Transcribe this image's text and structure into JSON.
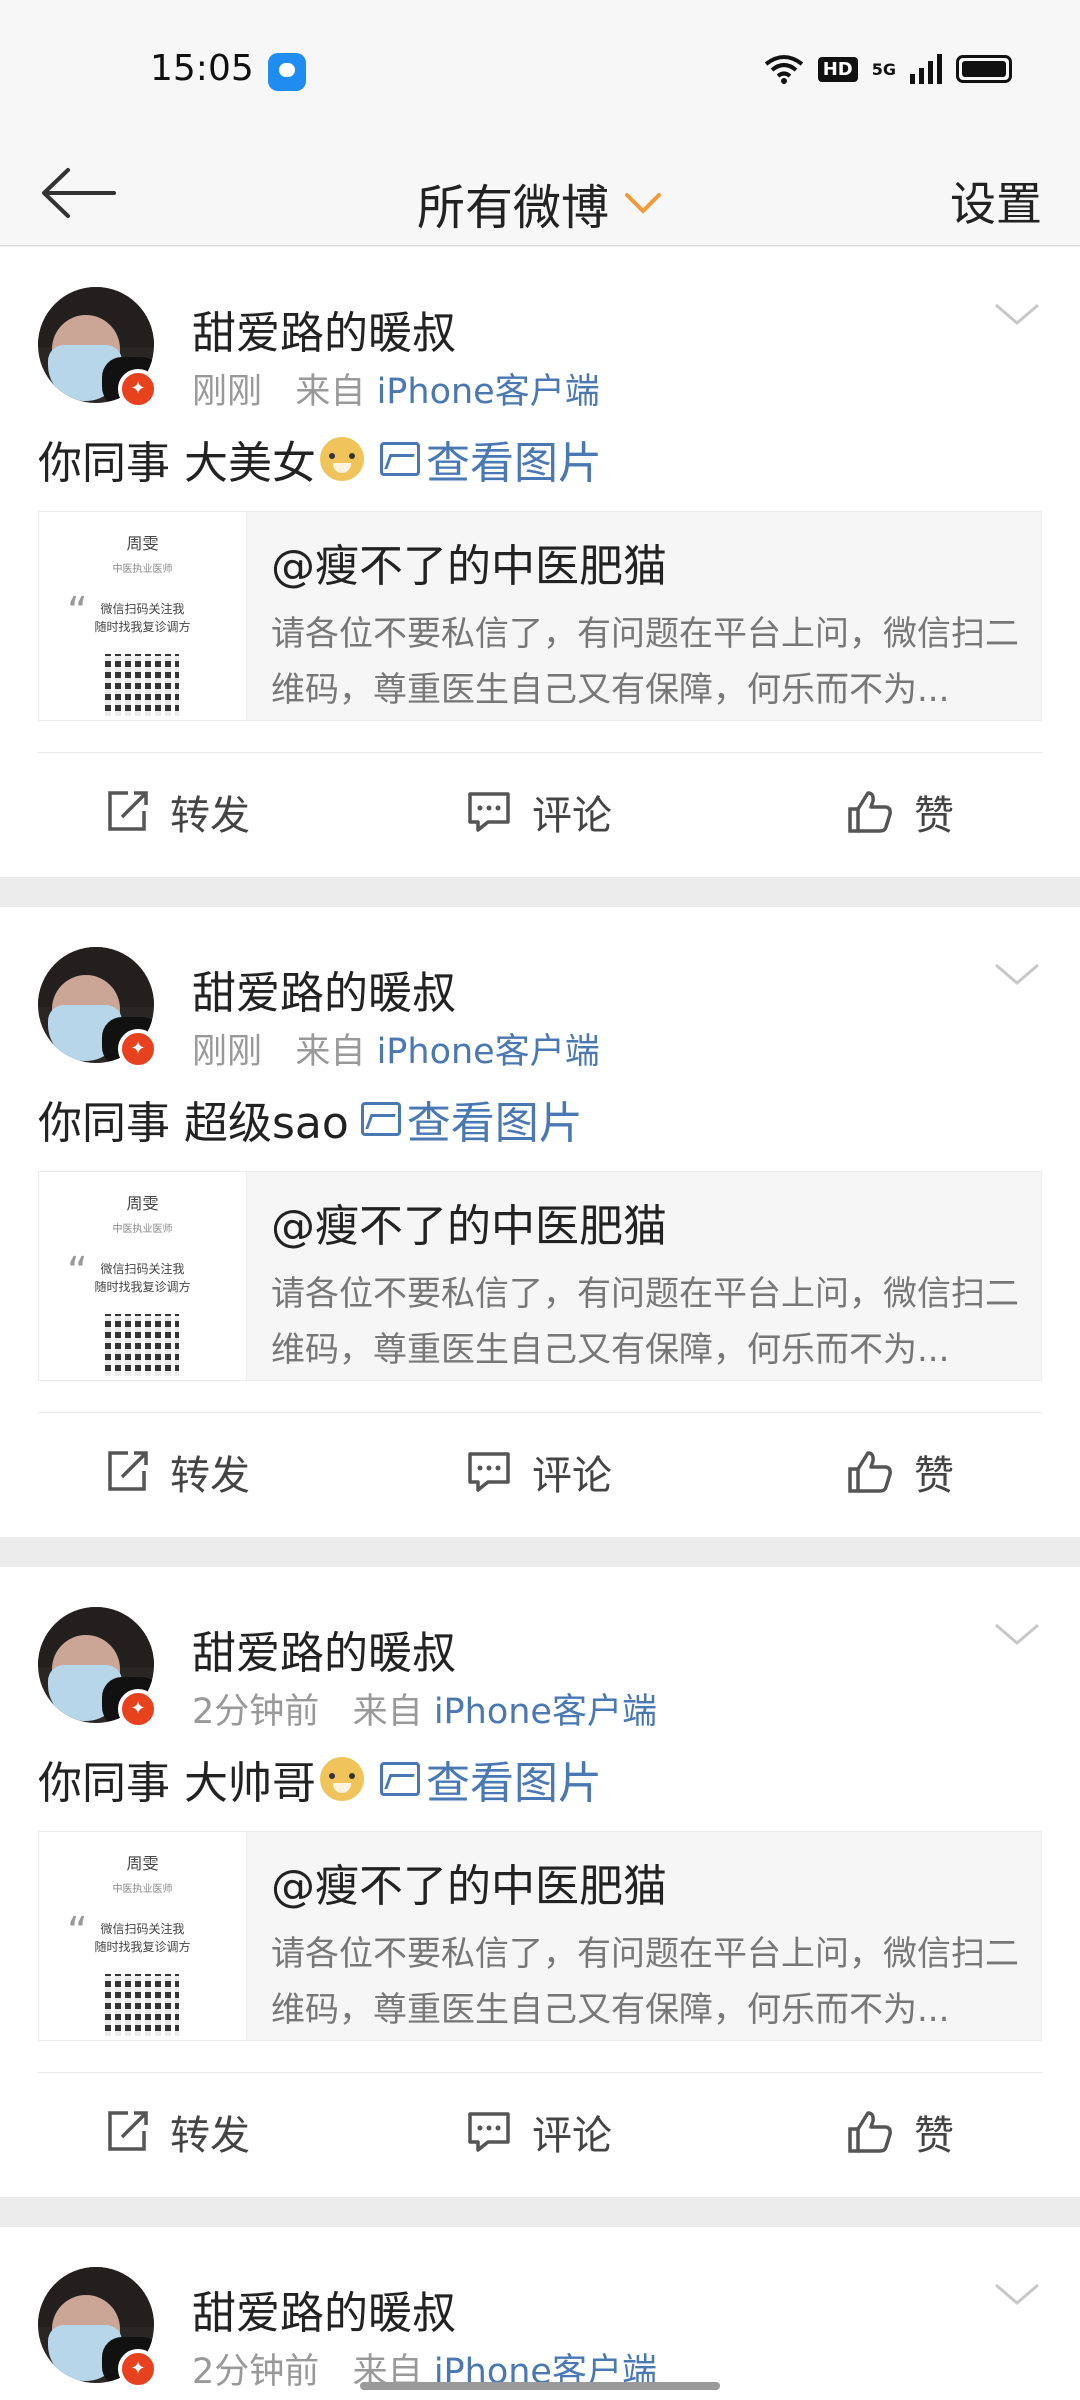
{
  "status_bar": {
    "time": "15:05",
    "hd": "HD",
    "network": "5G"
  },
  "nav": {
    "title": "所有微博",
    "settings": "设置"
  },
  "shared_post": {
    "title": "@瘦不了的中医肥猫",
    "text": "请各位不要私信了，有问题在平台上问，微信扫二维码，尊重医生自己又有保障，何乐而不为..."
  },
  "thumbnail": {
    "name": "周雯",
    "subtitle": "中医执业医师",
    "line1": "微信扫码关注我",
    "line2": "随时找我复诊调方"
  },
  "actions": {
    "repost": "转发",
    "comment": "评论",
    "like": "赞"
  },
  "posts": [
    {
      "user": "甜爱路的暖叔",
      "time": "刚刚",
      "from_prefix": "来自",
      "source": "iPhone客户端",
      "text": "你同事 大美女",
      "has_emoji": true,
      "link": "查看图片"
    },
    {
      "user": "甜爱路的暖叔",
      "time": "刚刚",
      "from_prefix": "来自",
      "source": "iPhone客户端",
      "text": "你同事 超级sao",
      "has_emoji": false,
      "link": "查看图片"
    },
    {
      "user": "甜爱路的暖叔",
      "time": "2分钟前",
      "from_prefix": "来自",
      "source": "iPhone客户端",
      "text": "你同事 大帅哥",
      "has_emoji": true,
      "link": "查看图片"
    },
    {
      "user": "甜爱路的暖叔",
      "time": "2分钟前",
      "from_prefix": "来自",
      "source": "iPhone客户端"
    }
  ]
}
